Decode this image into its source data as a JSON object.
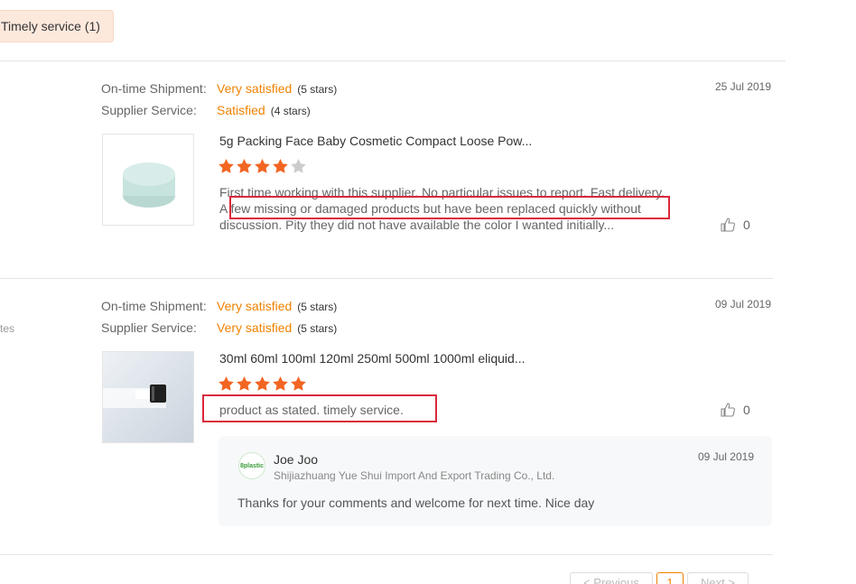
{
  "filter_tag": {
    "label": "Timely service (1)"
  },
  "left_note": "tes",
  "reviews": [
    {
      "shipment_label": "On-time Shipment:",
      "shipment_value": "Very satisfied",
      "shipment_stars": "(5 stars)",
      "service_label": "Supplier Service:",
      "service_value": "Satisfied",
      "service_stars": "(4 stars)",
      "date": "25 Jul 2019",
      "product_title": "5g Packing Face Baby Cosmetic Compact Loose Pow...",
      "rating": 4,
      "comment": "First time working with this supplier. No particular issues to report. Fast delivery. A few missing or damaged products but have been replaced quickly without discussion. Pity they did not have available the color I wanted initially...",
      "likes": "0"
    },
    {
      "shipment_label": "On-time Shipment:",
      "shipment_value": "Very satisfied",
      "shipment_stars": "(5 stars)",
      "service_label": "Supplier Service:",
      "service_value": "Very satisfied",
      "service_stars": "(5 stars)",
      "date": "09 Jul 2019",
      "product_title": "30ml 60ml 100ml 120ml 250ml 500ml 1000ml eliquid...",
      "rating": 5,
      "comment": "product as stated. timely service.",
      "likes": "0",
      "reply": {
        "name": "Joe Joo",
        "company": "Shijiazhuang Yue Shui Import And Export Trading Co., Ltd.",
        "date": "09 Jul 2019",
        "text": "Thanks for your comments and welcome for next time. Nice day",
        "avatar_text": "8plastic"
      }
    }
  ],
  "pagination": {
    "previous": "< Previous",
    "current": "1",
    "next": "Next >"
  },
  "colors": {
    "accent": "#f08200",
    "star_filled": "#f26522",
    "star_empty": "#cccccc",
    "highlight_border": "#d9283c",
    "tag_bg": "#fde8dc"
  }
}
